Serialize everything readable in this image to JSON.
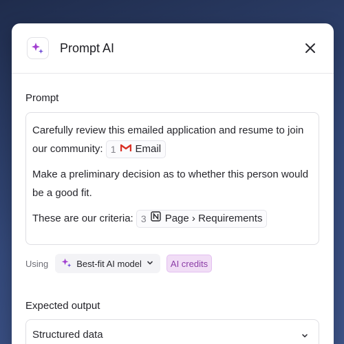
{
  "dialog": {
    "title": "Prompt AI",
    "accent_color": "#a23fd0"
  },
  "prompt": {
    "label": "Prompt",
    "line1_text": "Carefully review this emailed application and resume to join our community:",
    "email_chip": {
      "number": "1",
      "icon": "gmail-icon",
      "label": "Email"
    },
    "paragraph2": "Make a preliminary decision as to whether this person would be a good fit.",
    "line3_text": "These are our criteria:",
    "page_chip": {
      "number": "3",
      "icon": "notion-icon",
      "label": "Page › Requirements"
    }
  },
  "model_row": {
    "using_label": "Using",
    "model_label": "Best-fit AI model",
    "credits_label": "AI credits"
  },
  "output": {
    "label": "Expected output",
    "selected_value": "Structured data"
  }
}
